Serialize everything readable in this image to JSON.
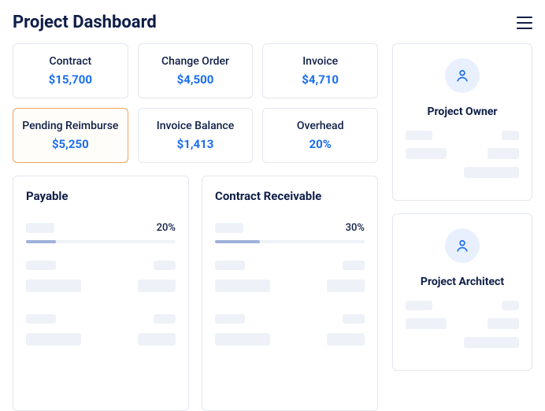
{
  "header": {
    "title": "Project Dashboard"
  },
  "stats": [
    {
      "label": "Contract",
      "value": "$15,700",
      "highlight": false
    },
    {
      "label": "Change Order",
      "value": "$4,500",
      "highlight": false
    },
    {
      "label": "Invoice",
      "value": "$4,710",
      "highlight": false
    },
    {
      "label": "Pending Reimburse",
      "value": "$5,250",
      "highlight": true
    },
    {
      "label": "Invoice Balance",
      "value": "$1,413",
      "highlight": false
    },
    {
      "label": "Overhead",
      "value": "20%",
      "highlight": false
    }
  ],
  "panels": {
    "payable": {
      "title": "Payable",
      "percent": "20%",
      "fill": 20
    },
    "receivable": {
      "title": "Contract Receivable",
      "percent": "30%",
      "fill": 30
    }
  },
  "people": {
    "owner": {
      "title": "Project Owner"
    },
    "architect": {
      "title": "Project Architect"
    }
  }
}
